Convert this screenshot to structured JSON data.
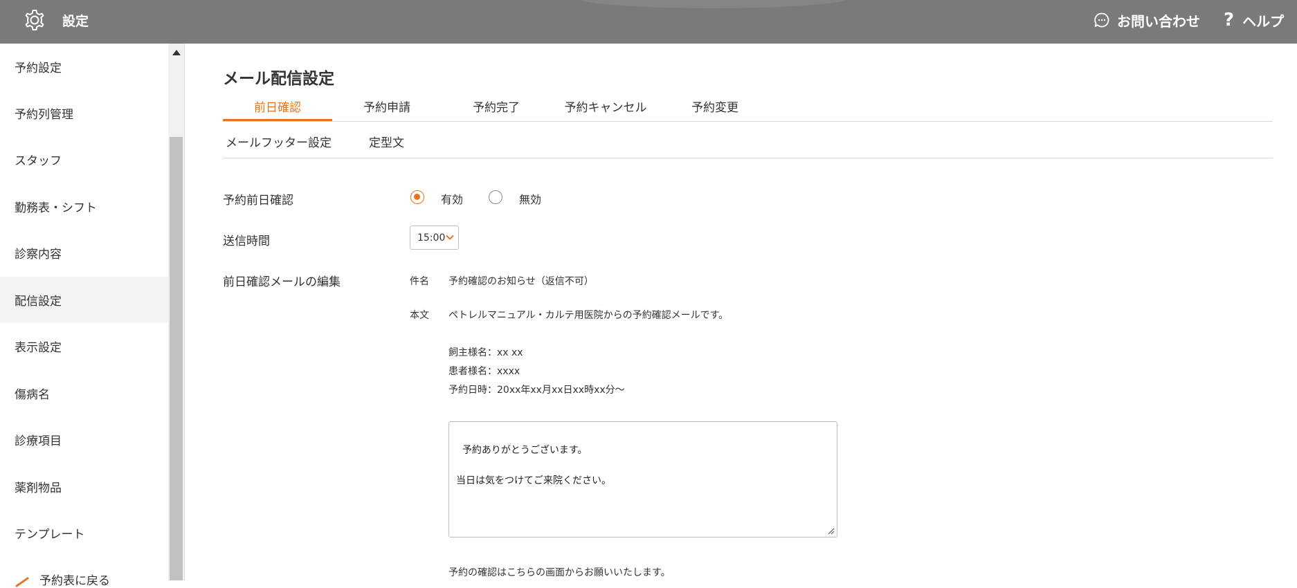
{
  "header": {
    "title": "設定",
    "gear_icon": "gear-icon",
    "contact_label": "お問い合わせ",
    "contact_icon": "chat-bubble-icon",
    "help_label": "ヘルプ",
    "help_icon": "question-mark-icon"
  },
  "sidebar": {
    "items": [
      {
        "label": "予約設定"
      },
      {
        "label": "予約列管理"
      },
      {
        "label": "スタッフ"
      },
      {
        "label": "勤務表・シフト"
      },
      {
        "label": "診察内容"
      },
      {
        "label": "配信設定"
      },
      {
        "label": "表示設定"
      },
      {
        "label": "傷病名"
      },
      {
        "label": "診療項目"
      },
      {
        "label": "薬剤物品"
      },
      {
        "label": "テンプレート"
      }
    ],
    "back_label": "予約表に戻る",
    "active": "配信設定"
  },
  "main": {
    "title": "メール配信設定",
    "tabs": [
      {
        "label": "前日確認"
      },
      {
        "label": "予約申請"
      },
      {
        "label": "予約完了"
      },
      {
        "label": "予約キャンセル"
      },
      {
        "label": "予約変更"
      }
    ],
    "sub_tabs": [
      {
        "label": "メールフッター設定"
      },
      {
        "label": "定型文"
      }
    ],
    "active_tab": "前日確認"
  },
  "form": {
    "reminder_label": "予約前日確認",
    "enabled_label": "有効",
    "disabled_label": "無効",
    "reminder_selected": "有効",
    "send_time_label": "送信時間",
    "send_time_value": "15:00",
    "edit_label": "前日確認メールの編集",
    "subject_label": "件名",
    "subject_value": "予約確認のお知らせ（返信不可）",
    "body_label": "本文",
    "body_intro": "ペトレルマニュアル・カルテ用医院からの予約確認メールです。",
    "owner_line": "飼主様名：xx xx",
    "patient_line": "患者様名：xxxx",
    "datetime_line": "予約日時：20xx年xx月xx日xx時xx分〜",
    "custom_message": "予約ありがとうございます。\n\n当日は気をつけてご来院ください。",
    "footer_line": "予約の確認はこちらの画面からお願いいたします。"
  },
  "colors": {
    "header_bg": "#7a7a7a",
    "accent": "#e8731f",
    "sidebar_active_bg": "#f3f3f3"
  }
}
